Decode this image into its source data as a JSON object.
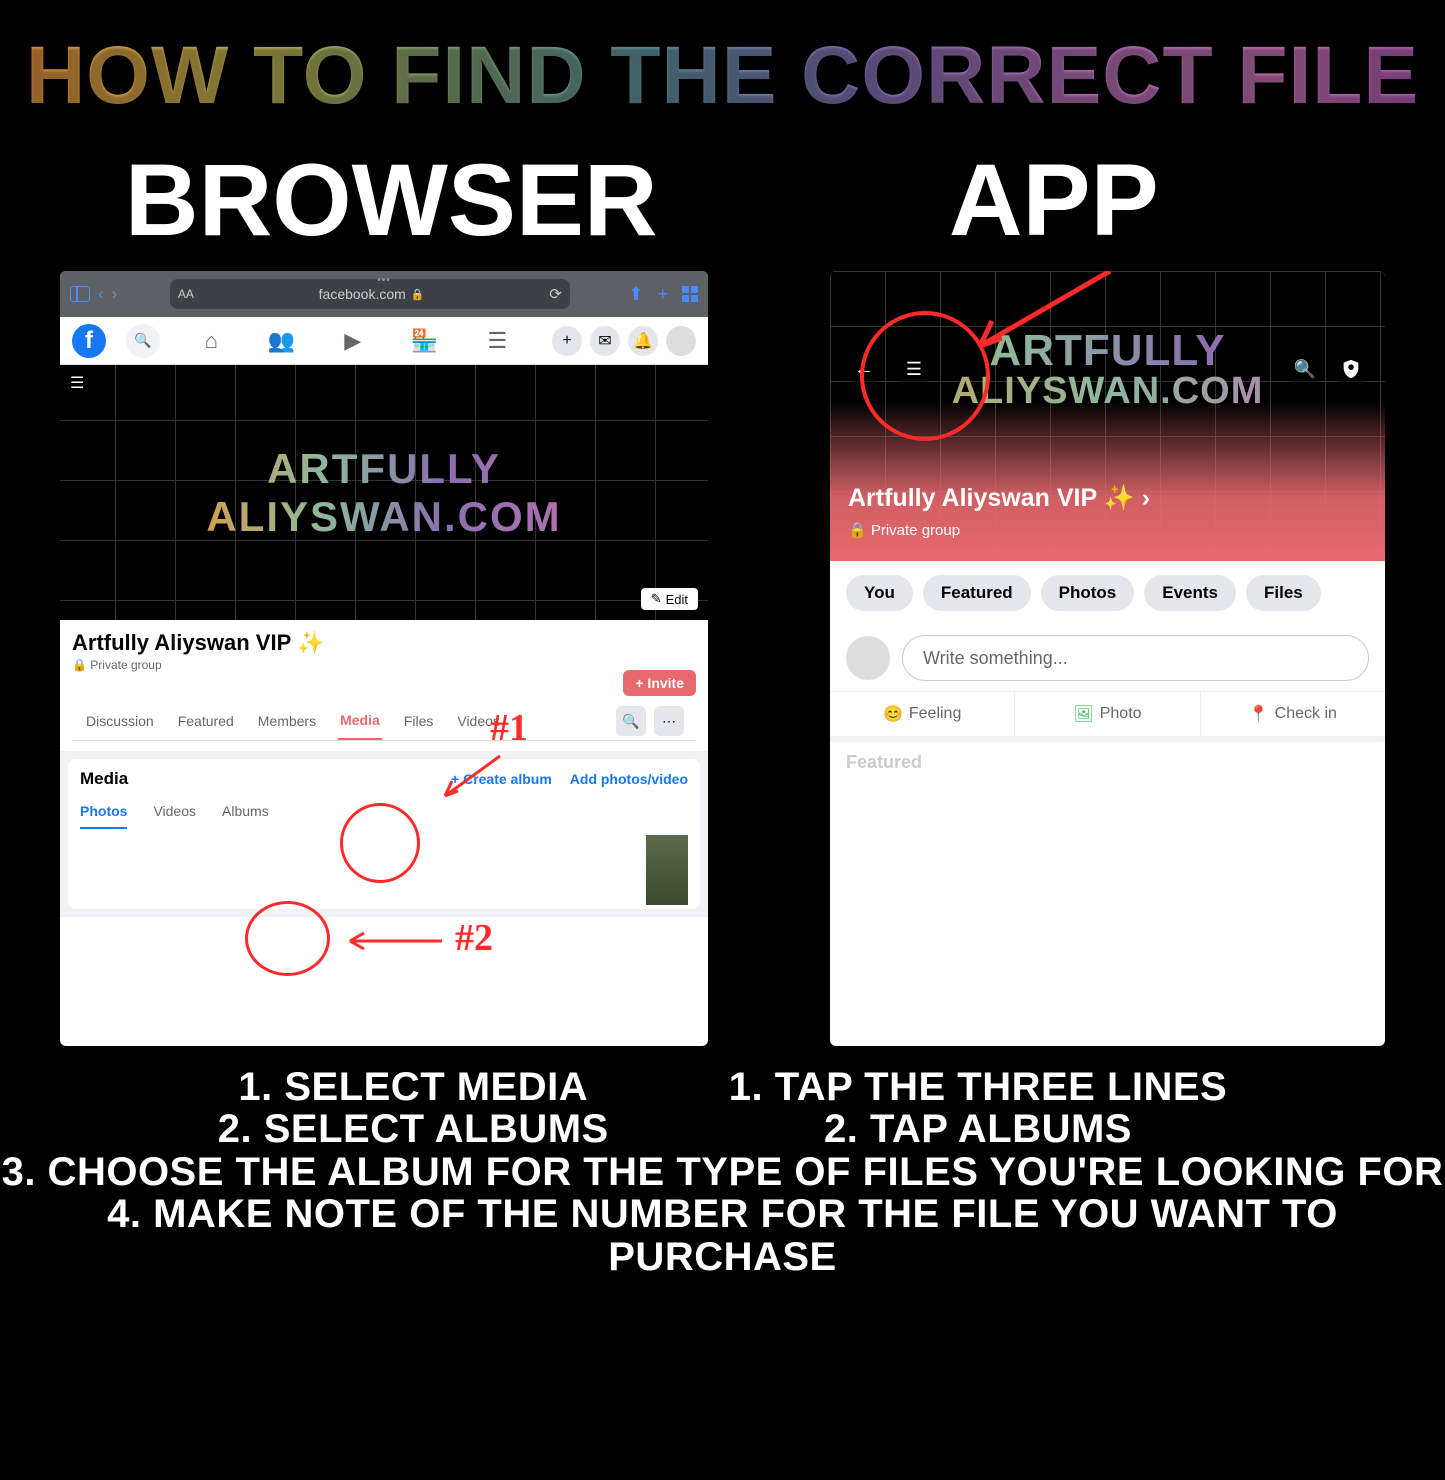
{
  "main_title": "HOW TO FIND THE CORRECT FILE",
  "section_browser": "BROWSER",
  "section_app": "APP",
  "safari": {
    "url": "facebook.com",
    "aa": "AA",
    "lock": "🔒"
  },
  "fb": {
    "logo": "f"
  },
  "cover": {
    "line1": "ARTFULLY",
    "line2": "ALIYSWAN.COM",
    "edit": "Edit"
  },
  "group": {
    "name": "Artfully Aliyswan VIP ✨",
    "priv": "🔒 Private group",
    "invite": "+  Invite"
  },
  "tabs": [
    "Discussion",
    "Featured",
    "Members",
    "Media",
    "Files",
    "Videos"
  ],
  "media": {
    "title": "Media",
    "create": "+  Create album",
    "add": "Add photos/video",
    "subtabs": [
      "Photos",
      "Videos",
      "Albums"
    ]
  },
  "ann": {
    "one": "#1",
    "two": "#2"
  },
  "app": {
    "group_name": "Artfully Aliyswan VIP ✨  ›",
    "priv": "🔒  Private group",
    "pills": [
      "You",
      "Featured",
      "Photos",
      "Events",
      "Files"
    ],
    "compose_placeholder": "Write something...",
    "actions": {
      "feeling": "Feeling",
      "photo": "Photo",
      "checkin": "Check in"
    },
    "featured": "Featured"
  },
  "inst": {
    "b1": "1. SELECT MEDIA",
    "b2": "2. SELECT ALBUMS",
    "a1": "1. TAP THE THREE LINES",
    "a2": "2. TAP ALBUMS",
    "s3": "3. CHOOSE THE ALBUM FOR THE TYPE OF FILES YOU'RE LOOKING FOR",
    "s4": "4. MAKE NOTE OF THE NUMBER FOR THE FILE YOU WANT TO PURCHASE"
  }
}
